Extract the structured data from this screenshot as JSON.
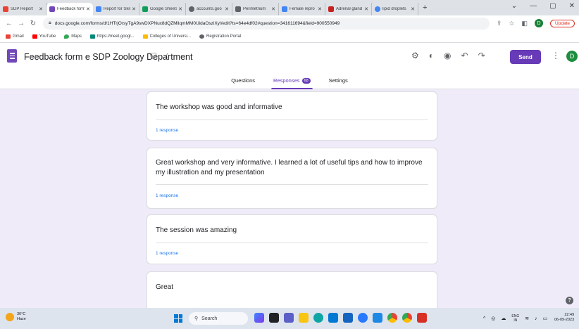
{
  "browser": {
    "tabs": [
      {
        "label": "SDP Report",
        "color": "#ea4335",
        "active": false
      },
      {
        "label": "Feedback form",
        "color": "#7248b9",
        "active": true
      },
      {
        "label": "Report for Skil",
        "color": "#4285f4",
        "active": false
      },
      {
        "label": "Google Sheets",
        "color": "#0f9d58",
        "active": false
      },
      {
        "label": "accounts.goo",
        "color": "#5f6368",
        "active": false
      },
      {
        "label": "Perimetrium",
        "color": "#5f6368",
        "active": false
      },
      {
        "label": "Female repro",
        "color": "#4285f4",
        "active": false
      },
      {
        "label": "Adrenal gland",
        "color": "#c5221f",
        "active": false
      },
      {
        "label": "lipid droplets",
        "color": "#4285f4",
        "active": false
      }
    ],
    "new_tab": "+",
    "url": "docs.google.com/forms/d/1HTrjOrsyTgA9swDXPNux8dQZMilqmMM0UidaOsziXyI/edit?ts=64e4df02#question=341611694&field=900550949",
    "update_label": "Update",
    "profile_initial": "D",
    "bookmarks": [
      {
        "label": "Gmail",
        "color": "#ea4335"
      },
      {
        "label": "YouTube",
        "color": "#ff0000"
      },
      {
        "label": "Maps",
        "color": "#34a853"
      },
      {
        "label": "https://meet.googl...",
        "color": "#00897b"
      },
      {
        "label": "Colleges of Universi...",
        "color": "#fbbc04"
      },
      {
        "label": "Registration Portal",
        "color": "#5f6368"
      }
    ]
  },
  "form": {
    "title": "Feedback form e SDP Zoology Department",
    "send_label": "Send",
    "avatar_initial": "D",
    "tabs": {
      "questions": "Questions",
      "responses": "Responses",
      "responses_count": "68",
      "settings": "Settings"
    },
    "responses": [
      {
        "text": "The workshop was good and informative",
        "count": "1 response"
      },
      {
        "text": "Great workshop and very informative. I learned a lot of useful tips and how to improve my illustration and my presentation",
        "count": "1 response"
      },
      {
        "text": "The session was amazing",
        "count": "1 response"
      },
      {
        "text": "Great",
        "count": ""
      }
    ],
    "accent_color": "#673ab7"
  },
  "taskbar": {
    "weather_temp": "30°C",
    "weather_desc": "Haze",
    "search_placeholder": "Search",
    "lang_line1": "ENG",
    "lang_line2": "IN",
    "time": "22:49",
    "date": "06-09-2023"
  }
}
